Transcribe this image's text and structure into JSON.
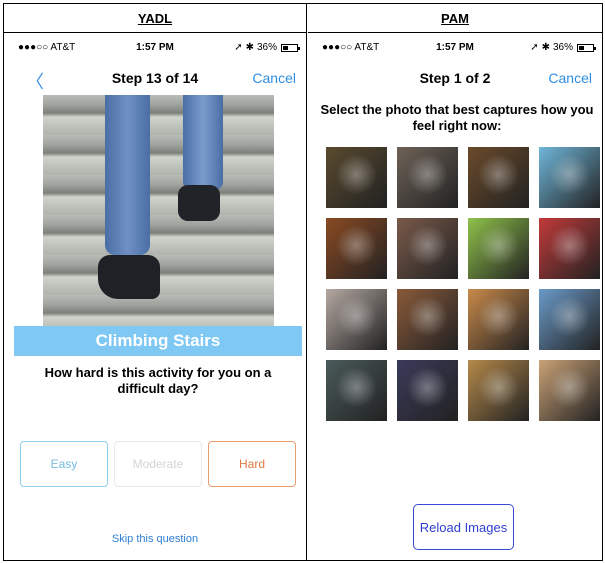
{
  "columns": {
    "left_title": "YADL",
    "right_title": "PAM"
  },
  "status_bar": {
    "carrier": "●●●○○ AT&T",
    "time": "1:57 PM",
    "battery": "36%",
    "location_glyph": "➚",
    "bluetooth_glyph": "✱",
    "wifi_glyph": "ᯤ"
  },
  "yadl": {
    "back_glyph": "〈",
    "title": "Step 13 of 14",
    "cancel": "Cancel",
    "activity": "Climbing Stairs",
    "question": "How hard is this activity for you on a difficult day?",
    "options": {
      "easy": "Easy",
      "moderate": "Moderate",
      "hard": "Hard"
    },
    "skip": "Skip this question"
  },
  "pam": {
    "title": "Step 1 of 2",
    "cancel": "Cancel",
    "prompt": "Select the photo that best captures how you feel right now:",
    "reload": "Reload Images",
    "photos": [
      {
        "icon": "cat-photo",
        "color": "#5a4a2e"
      },
      {
        "icon": "woman-photo",
        "color": "#6e6258"
      },
      {
        "icon": "dog-running-photo",
        "color": "#6a4a2a"
      },
      {
        "icon": "kid-icecream-photo",
        "color": "#6fb6d9"
      },
      {
        "icon": "woman-shouting-photo",
        "color": "#8a4a22"
      },
      {
        "icon": "angry-man-photo",
        "color": "#7a5a4a"
      },
      {
        "icon": "smiley-face-photo",
        "color": "#8fc24a"
      },
      {
        "icon": "friends-selfie-photo",
        "color": "#c23a3a"
      },
      {
        "icon": "sad-sculpture-photo",
        "color": "#b5a9a2"
      },
      {
        "icon": "sad-dog-photo",
        "color": "#8a5a3a"
      },
      {
        "icon": "sunset-lake-photo",
        "color": "#c98a4a"
      },
      {
        "icon": "white-dog-photo",
        "color": "#6a9ac8"
      },
      {
        "icon": "stormy-sky-photo",
        "color": "#4a5a5a"
      },
      {
        "icon": "man-sleeping-photo",
        "color": "#3a3a5a"
      },
      {
        "icon": "sleepy-dog-photo",
        "color": "#b58a4a"
      },
      {
        "icon": "desert-photo",
        "color": "#c9a276"
      }
    ]
  }
}
